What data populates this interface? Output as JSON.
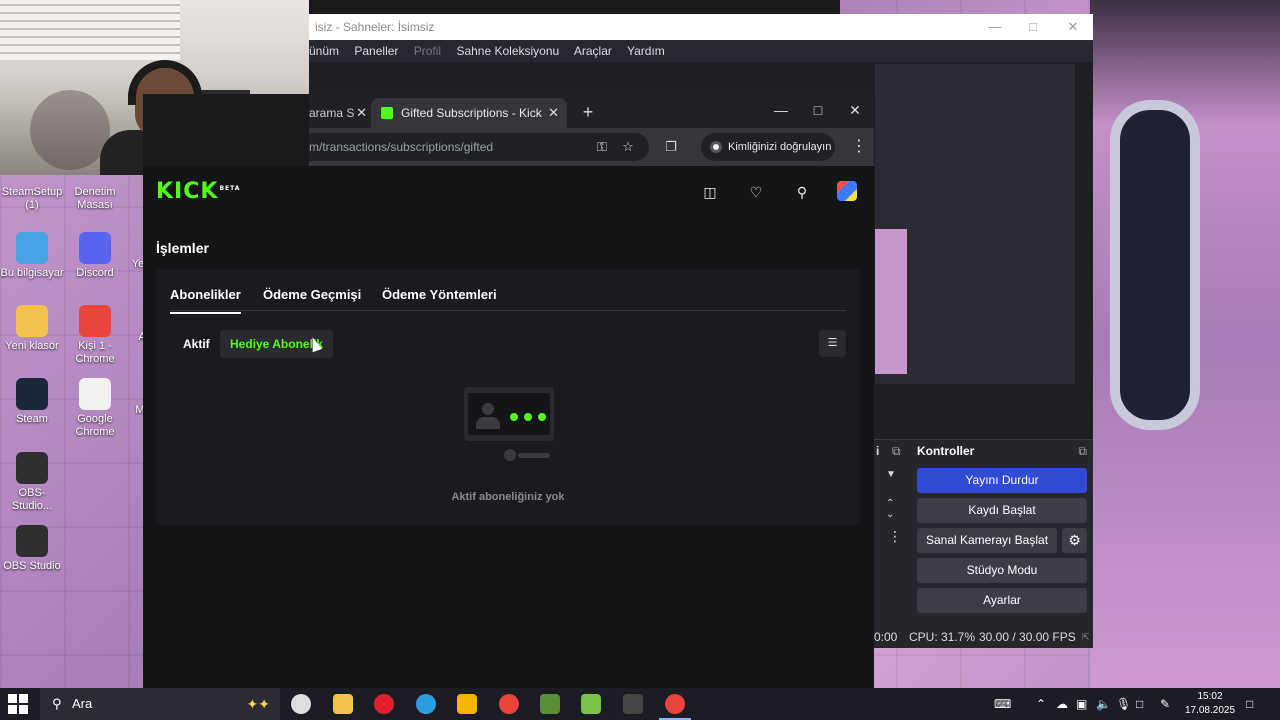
{
  "desktop": {
    "icons": [
      {
        "name": "desk-icon-steamsetup",
        "label": "SteamSetup (1)",
        "color": "#3f6fb5"
      },
      {
        "name": "desk-icon-control-panel",
        "label": "Denetim Masası",
        "color": "#2f8fd8"
      },
      {
        "name": "desk-icon-this-pc",
        "label": "Bu bilgisayar",
        "color": "#4aa3e6"
      },
      {
        "name": "desk-icon-discord",
        "label": "Discord",
        "color": "#5865f2"
      },
      {
        "name": "desk-icon-new-folder",
        "label": "Yeni klasör",
        "color": "#f2c14e"
      },
      {
        "name": "desk-icon-chrome-person",
        "label": "Kişi 1 - Chrome",
        "color": "#e8453c"
      },
      {
        "name": "desk-icon-steam",
        "label": "Steam",
        "color": "#1b2838"
      },
      {
        "name": "desk-icon-google-chrome",
        "label": "Google Chrome",
        "color": "#f1f1f1"
      },
      {
        "name": "desk-icon-obs-shortcut",
        "label": "OBS-Studio...",
        "color": "#302e31"
      },
      {
        "name": "desk-icon-obs-studio",
        "label": "OBS Studio",
        "color": "#302e31"
      }
    ],
    "partial_labels": [
      "Ye",
      "A",
      "M"
    ]
  },
  "obs": {
    "title": "isiz - Sahneler: İsimsiz",
    "menu": [
      "ünüm",
      "Paneller",
      "Profil",
      "Sahne Koleksiyonu",
      "Araçlar",
      "Yardım"
    ],
    "controls_title": "Kontroller",
    "buttons": {
      "stop_stream": "Yayını Durdur",
      "start_record": "Kaydı Başlat",
      "virtual_camera": "Sanal Kamerayı Başlat",
      "studio_mode": "Stüdyo Modu",
      "settings": "Ayarlar"
    },
    "status": {
      "time": "0:00",
      "cpu": "CPU: 31.7%",
      "fps": "30.00 / 30.00 FPS"
    },
    "accent": "#2f4bd3"
  },
  "chrome": {
    "tabs": [
      {
        "label": "arama S",
        "active": false
      },
      {
        "label": "Gifted Subscriptions - Kick Stre",
        "active": true
      }
    ],
    "url": "m/transactions/subscriptions/gifted",
    "verify_label": "Kimliğinizi doğrulayın"
  },
  "kick": {
    "logo": "KICK",
    "logo_badge": "BETA",
    "page_title": "İşlemler",
    "tabs": [
      "Abonelikler",
      "Ödeme Geçmişi",
      "Ödeme Yöntemleri"
    ],
    "active_tab": "Abonelikler",
    "filters": [
      "Aktif",
      "Hediye Abonelik"
    ],
    "selected_filter": "Hediye Abonelik",
    "empty_text": "Aktif aboneliğiniz yok",
    "brand_color": "#53fc18"
  },
  "taskbar": {
    "search_placeholder": "Ara",
    "time": "15:02",
    "date": "17.08.2025",
    "pinned_icons": [
      {
        "name": "task-view-icon",
        "color": "#dddddd"
      },
      {
        "name": "file-explorer-icon",
        "color": "#f2c14e"
      },
      {
        "name": "opera-icon",
        "color": "#e4202d"
      },
      {
        "name": "edge-icon",
        "color": "#2c9cdc"
      },
      {
        "name": "notes-app-icon",
        "color": "#f4b400"
      },
      {
        "name": "chrome-icon",
        "color": "#e8453c"
      },
      {
        "name": "minecraft-launcher-icon",
        "color": "#5a8f3a"
      },
      {
        "name": "minecraft-icon",
        "color": "#7cc24a"
      },
      {
        "name": "obs-icon",
        "color": "#444444"
      },
      {
        "name": "chrome-profile-icon",
        "color": "#e8453c"
      }
    ]
  }
}
